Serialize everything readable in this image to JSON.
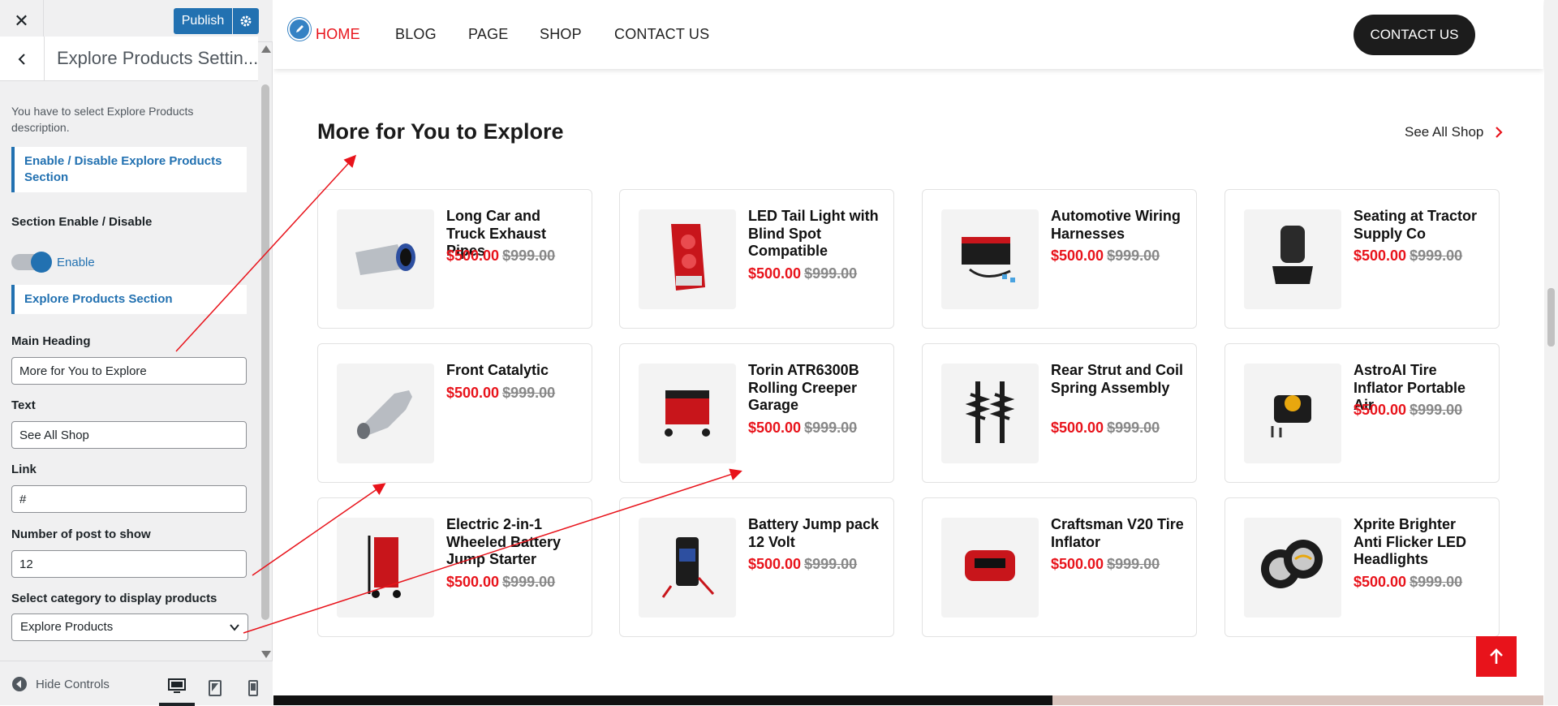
{
  "customizer": {
    "close_label": "✕",
    "publish_label": "Publish",
    "section_title": "Explore Products Settin...",
    "description": "You have to select Explore Products description.",
    "group_enable": "Enable / Disable Explore Products Section",
    "section_enable_label": "Section Enable / Disable",
    "toggle_state": "Enable",
    "group_section": "Explore Products Section",
    "main_heading_label": "Main Heading",
    "main_heading_value": "More for You to Explore",
    "text_label": "Text",
    "text_value": "See All Shop",
    "link_label": "Link",
    "link_value": "#",
    "num_posts_label": "Number of post to show",
    "num_posts_value": "12",
    "category_label": "Select category to display products",
    "category_value": "Explore Products",
    "hide_controls": "Hide Controls"
  },
  "site": {
    "nav": [
      "HOME",
      "BLOG",
      "PAGE",
      "SHOP",
      "CONTACT US"
    ],
    "contact_button": "CONTACT US",
    "section_heading": "More for You to Explore",
    "see_all": "See All Shop",
    "accent": "#e8131b"
  },
  "products": [
    {
      "name": "Long Car and Truck Exhaust Pipes",
      "price": "$500.00",
      "old_price": "$999.00",
      "icon": "exhaust-pipe-icon"
    },
    {
      "name": "LED Tail Light with Blind Spot Compatible",
      "price": "$500.00",
      "old_price": "$999.00",
      "icon": "tail-light-icon"
    },
    {
      "name": "Automotive Wiring Harnesses",
      "price": "$500.00",
      "old_price": "$999.00",
      "icon": "wiring-harness-icon"
    },
    {
      "name": "Seating at Tractor Supply Co",
      "price": "$500.00",
      "old_price": "$999.00",
      "icon": "seat-icon"
    },
    {
      "name": "Front Catalytic",
      "price": "$500.00",
      "old_price": "$999.00",
      "icon": "catalytic-converter-icon"
    },
    {
      "name": "Torin ATR6300B Rolling Creeper Garage",
      "price": "$500.00",
      "old_price": "$999.00",
      "icon": "creeper-seat-icon"
    },
    {
      "name": "Rear Strut and Coil Spring Assembly",
      "price": "$500.00",
      "old_price": "$999.00",
      "icon": "strut-icon"
    },
    {
      "name": "AstroAI Tire Inflator Portable Air",
      "price": "$500.00",
      "old_price": "$999.00",
      "icon": "tire-inflator-icon"
    },
    {
      "name": "Electric 2-in-1 Wheeled Battery Jump Starter",
      "price": "$500.00",
      "old_price": "$999.00",
      "icon": "battery-charger-icon"
    },
    {
      "name": "Battery Jump pack 12 Volt",
      "price": "$500.00",
      "old_price": "$999.00",
      "icon": "jump-pack-icon"
    },
    {
      "name": "Craftsman V20 Tire Inflator",
      "price": "$500.00",
      "old_price": "$999.00",
      "icon": "cordless-inflator-icon"
    },
    {
      "name": "Xprite Brighter Anti Flicker LED Headlights",
      "price": "$500.00",
      "old_price": "$999.00",
      "icon": "headlights-icon"
    }
  ]
}
